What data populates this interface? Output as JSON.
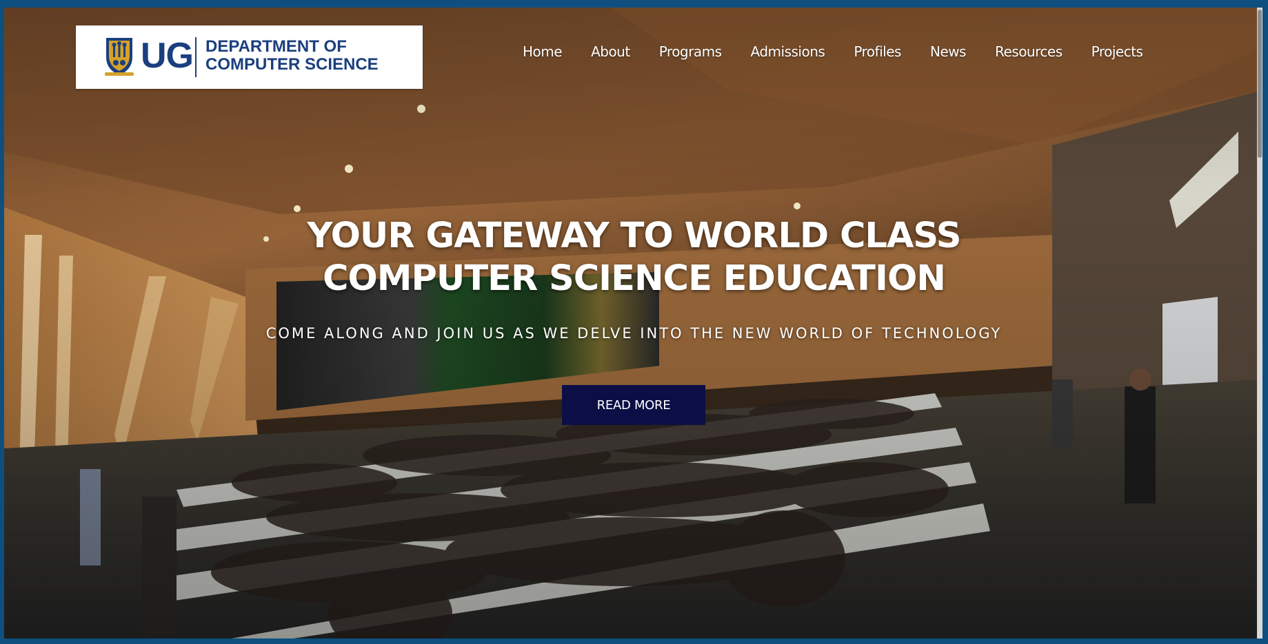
{
  "brand": {
    "short": "UG",
    "line1": "DEPARTMENT OF",
    "line2": "COMPUTER SCIENCE"
  },
  "nav": {
    "items": [
      "Home",
      "About",
      "Programs",
      "Admissions",
      "Profiles",
      "News",
      "Resources",
      "Projects"
    ]
  },
  "hero": {
    "headline_line1": "YOUR GATEWAY TO WORLD CLASS",
    "headline_line2": "COMPUTER SCIENCE EDUCATION",
    "subheadline": "COME ALONG AND JOIN US AS WE DELVE INTO THE NEW WORLD OF TECHNOLOGY",
    "button_label": "READ MORE"
  },
  "colors": {
    "frame": "#0f4f80",
    "brand_blue": "#1b3f7e",
    "button_bg": "#0b0f45"
  }
}
